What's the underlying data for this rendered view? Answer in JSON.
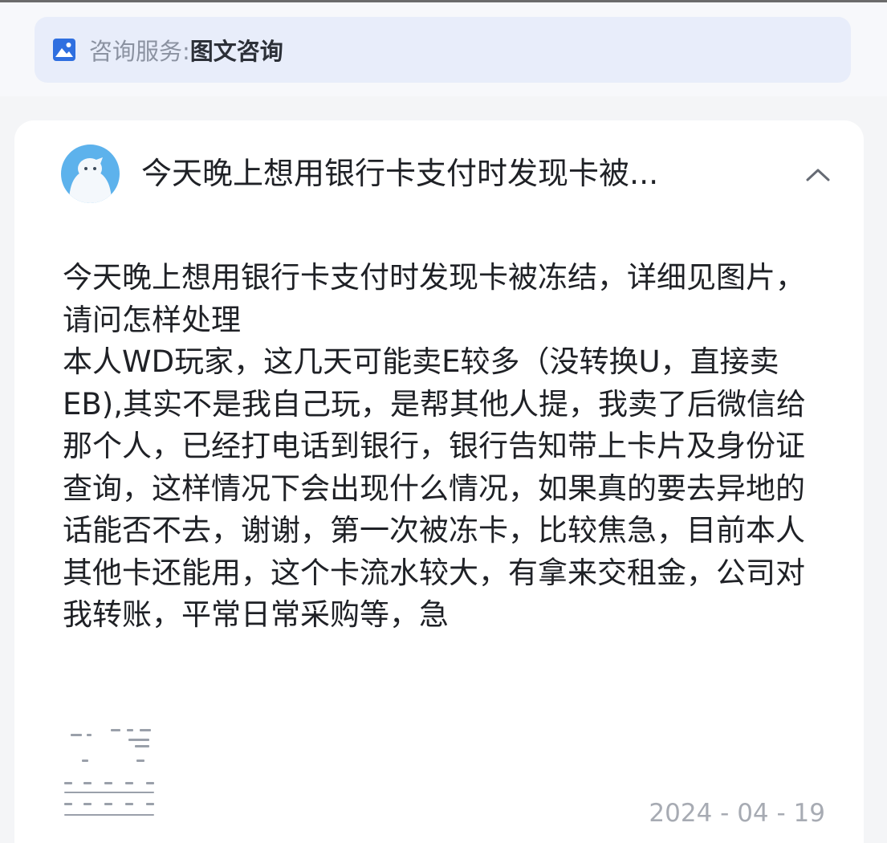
{
  "service": {
    "label": "咨询服务:",
    "value": "图文咨询",
    "icon": "image-icon",
    "icon_color": "#2f6fe0"
  },
  "question": {
    "avatar": "user-avatar",
    "title": "今天晚上想用银行卡支付时发现卡被...",
    "collapse_icon": "chevron-up-icon",
    "paragraphs": [
      "今天晚上想用银行卡支付时发现卡被冻结，详细见图片，请问怎样处理",
      "本人WD玩家，这几天可能卖E较多（没转换U，直接卖EB),其实不是我自己玩，是帮其他人提，我卖了后微信给那个人，已经打电话到银行，银行告知带上卡片及身份证查询，这样情况下会出现什么情况，如果真的要去异地的话能否不去，谢谢，第一次被冻卡，比较焦急，目前本人其他卡还能用，这个卡流水较大，有拿来交租金，公司对我转账，平常日常采购等，急"
    ],
    "attachment": "attachment-thumbnail",
    "date": "2024 - 04 - 19"
  }
}
